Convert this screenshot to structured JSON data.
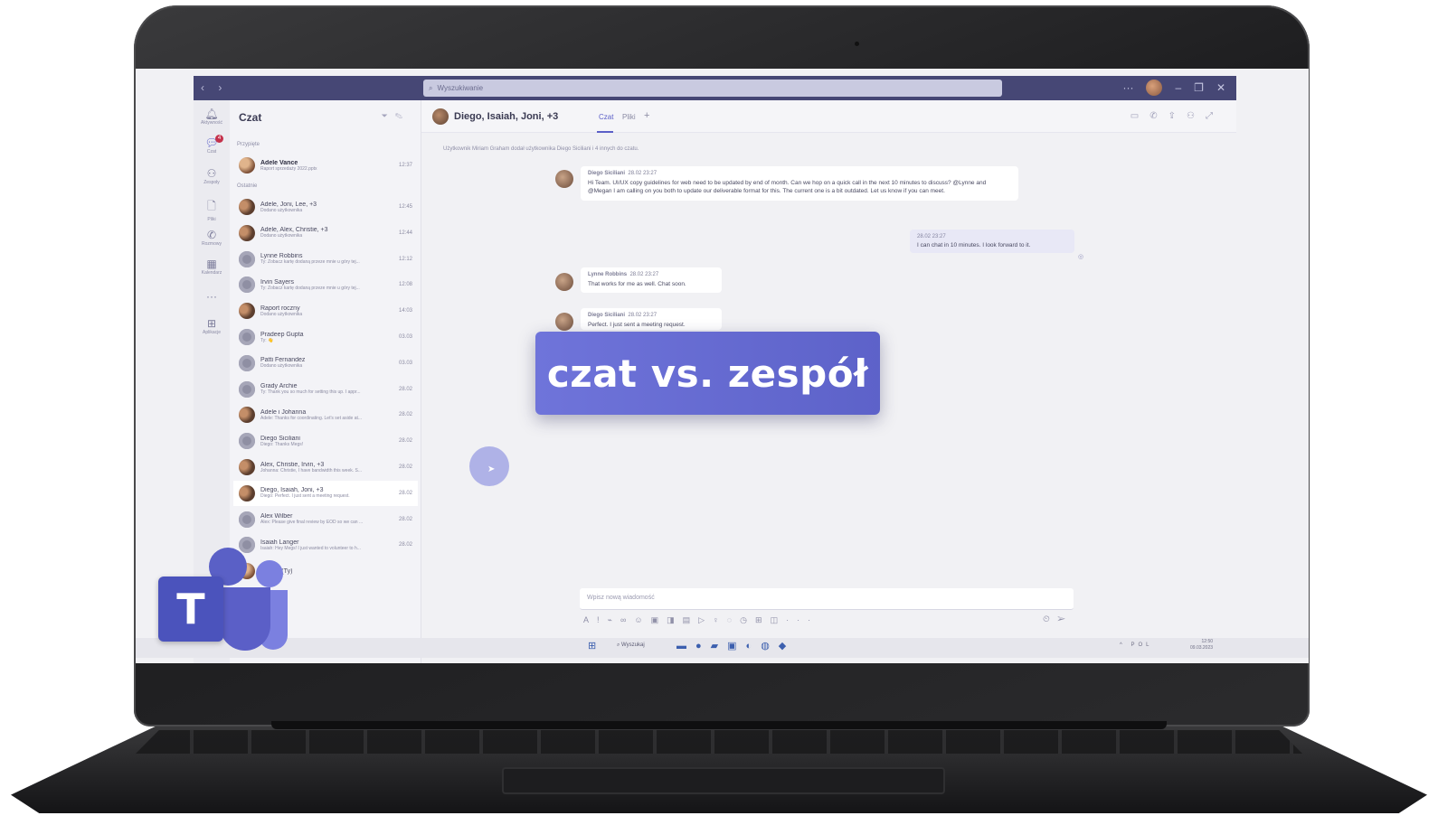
{
  "app": {
    "search_placeholder": "Wyszukiwanie",
    "nav_arrows": "‹ ›"
  },
  "rail": [
    {
      "icon": "bell-icon",
      "label": "Aktywność"
    },
    {
      "icon": "chat-icon",
      "label": "Czat",
      "badge": "4",
      "active": true
    },
    {
      "icon": "teams-icon",
      "label": "Zespoły"
    },
    {
      "icon": "files-icon",
      "label": "Pliki"
    },
    {
      "icon": "calls-icon",
      "label": "Rozmowy"
    },
    {
      "icon": "calendar-icon",
      "label": "Kalendarz"
    },
    {
      "icon": "more-icon",
      "label": "···"
    },
    {
      "icon": "apps-icon",
      "label": "Aplikacje"
    }
  ],
  "chat_list": {
    "title": "Czat",
    "pinned_label": "Przypięte",
    "recent_label": "Ostatnie",
    "pinned": [
      {
        "name": "Adele Vance",
        "preview": "Raport sprzedaży 2022.pptx",
        "time": "12:37",
        "avatar": "photo",
        "bold": true
      }
    ],
    "recent": [
      {
        "name": "Adele, Joni, Lee, +3",
        "preview": "Dodano użytkownika",
        "time": "12:45",
        "avatar": "group"
      },
      {
        "name": "Adele, Alex, Christie, +3",
        "preview": "Dodano użytkownika",
        "time": "12:44",
        "avatar": "group"
      },
      {
        "name": "Lynne Robbins",
        "preview": "Ty: Zobacz kartę dodaną przeze mnie u góry tej...",
        "time": "12:12",
        "avatar": "gray"
      },
      {
        "name": "Irvin Sayers",
        "preview": "Ty: Zobacz kartę dodaną przeze mnie u góry tej...",
        "time": "12:08",
        "avatar": "gray"
      },
      {
        "name": "Raport roczny",
        "preview": "Dodano użytkownika",
        "time": "14:03",
        "avatar": "group"
      },
      {
        "name": "Pradeep Gupta",
        "preview": "Ty: 👋",
        "time": "03.03",
        "avatar": "gray"
      },
      {
        "name": "Patti Fernandez",
        "preview": "Dodano użytkownika",
        "time": "03.03",
        "avatar": "gray"
      },
      {
        "name": "Grady Archie",
        "preview": "Ty: Thank you so much for setting this up. I appr...",
        "time": "28.02",
        "avatar": "gray"
      },
      {
        "name": "Adele i Johanna",
        "preview": "Adele: Thanks for coordinating. Let's set aside at...",
        "time": "28.02",
        "avatar": "group"
      },
      {
        "name": "Diego Siciliani",
        "preview": "Diego: Thanks Megs!",
        "time": "28.02",
        "avatar": "gray"
      },
      {
        "name": "Alex, Christie, Irvin, +3",
        "preview": "Johanna: Christie, I have bandwidth this week. S...",
        "time": "28.02",
        "avatar": "group"
      },
      {
        "name": "Diego, Isaiah, Joni, +3",
        "preview": "Diego: Perfect. I just sent a meeting request.",
        "time": "28.02",
        "avatar": "group",
        "selected": true
      },
      {
        "name": "Alex Wilber",
        "preview": "Alex: Please give final review by EOD so we can ...",
        "time": "28.02",
        "avatar": "gray"
      },
      {
        "name": "Isaiah Langer",
        "preview": "Isaiah: Hey Megs! I just wanted to volunteer to h...",
        "time": "28.02",
        "avatar": "gray"
      },
      {
        "name": "Bowen (Ty)",
        "preview": "",
        "time": "",
        "avatar": "photo"
      }
    ]
  },
  "chat": {
    "title": "Diego, Isaiah, Joni, +3",
    "tabs": [
      "Czat",
      "Pliki"
    ],
    "add_tab": "+",
    "system_message": "Użytkownik Miriam Graham dodał użytkownika Diego Siciliani i 4 innych do czatu.",
    "messages": [
      {
        "author": "Diego Siciliani",
        "time": "28.02 23:27",
        "text": "Hi Team. UI/UX copy guidelines for web need to be updated by end of month. Can we hop on a quick call in the next 10 minutes to discuss? @Lynne and @Megan I am calling on you both to update our deliverable format for this. The current one is a bit outdated. Let us know if you can meet."
      },
      {
        "author": "Lynne Robbins",
        "time": "28.02 23:27",
        "text": "That works for me as well. Chat soon."
      },
      {
        "author": "Diego Siciliani",
        "time": "28.02 23:27",
        "text": "Perfect. I just sent a meeting request."
      }
    ],
    "my_message": {
      "time": "28.02 23:27",
      "text": "I can chat in 10 minutes. I look forward to it."
    },
    "compose_placeholder": "Wpisz nową wiadomość"
  },
  "overlay_title": "czat vs. zespół",
  "taskbar": {
    "search_label": "Wyszukaj",
    "tray": "^ POL",
    "clock_time": "12:50",
    "clock_date": "09.03.2023"
  },
  "logo_letter": "T",
  "colors": {
    "accent": "#5b5fc7",
    "titlebar": "#464775",
    "overlay": "#6268d0"
  }
}
